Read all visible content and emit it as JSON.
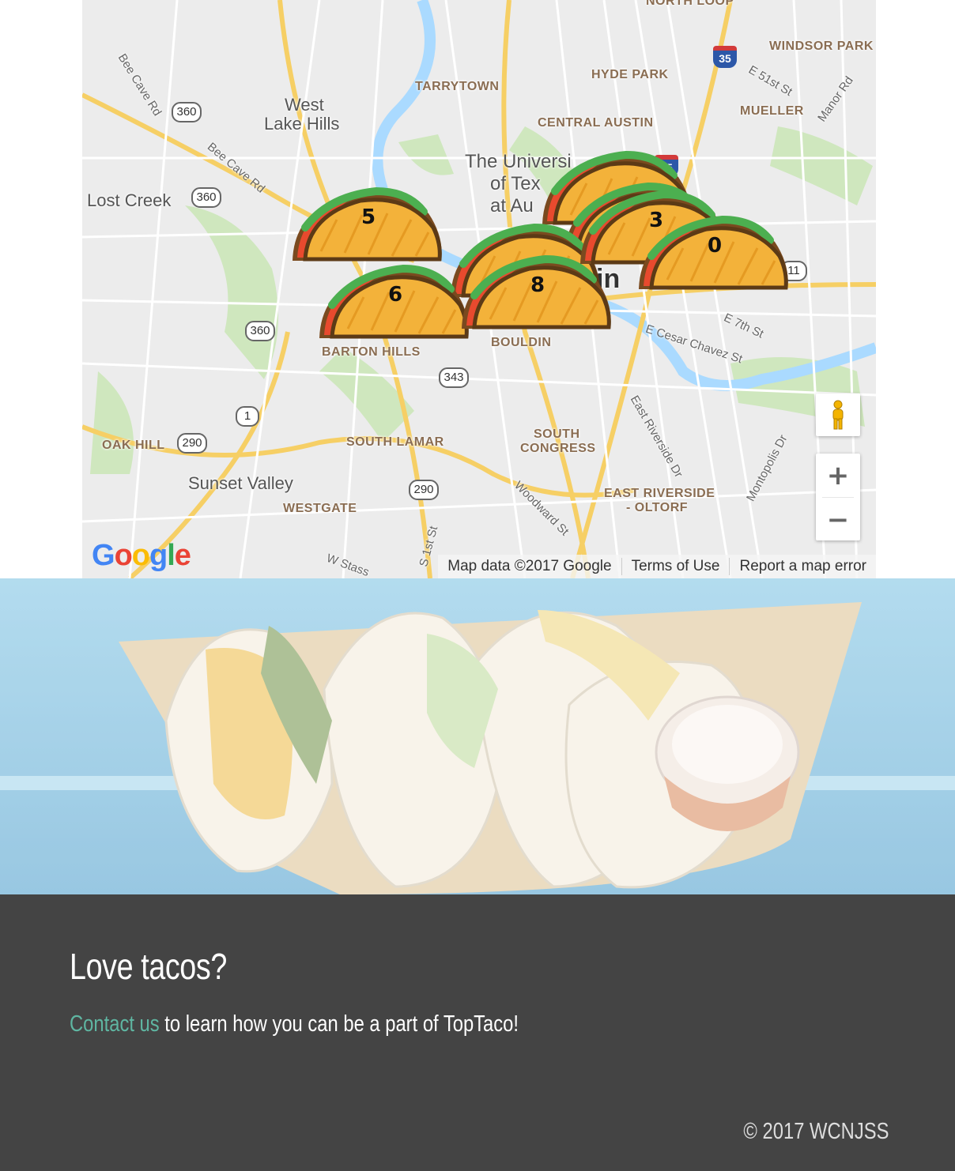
{
  "map": {
    "neighborhoods": [
      "NORTH LOOP",
      "WINDSOR PARK",
      "TARRYTOWN",
      "HYDE PARK",
      "MUELLER",
      "CENTRAL AUSTIN",
      "BARTON HILLS",
      "BOULDIN",
      "SOUTH LAMAR",
      "SOUTH",
      "CONGRESS",
      "OAK HILL",
      "WESTGATE",
      "EAST RIVERSIDE",
      "- OLTORF"
    ],
    "cities": [
      "West",
      "Lake Hills",
      "Lost Creek",
      "The Universi",
      "of Tex",
      "at Au",
      "Sunset Valley",
      "in"
    ],
    "streets": [
      "Bee Cave Rd",
      "Bee Cave Rd",
      "E 51st St",
      "Manor Rd",
      "E 7th St",
      "E Cesar Chavez St",
      "East Riverside Dr",
      "Montopolis Dr",
      "Woodward St",
      "S 1st St",
      "W Stass"
    ],
    "shields": [
      "360",
      "360",
      "360",
      "343",
      "1",
      "290",
      "290",
      "35",
      "35",
      "11"
    ],
    "markers": [
      {
        "count": "5",
        "label": "taco-cluster-marker"
      },
      {
        "count": "6",
        "label": "taco-cluster-marker"
      },
      {
        "count": "8",
        "label": "taco-cluster-marker"
      },
      {
        "count": "3",
        "label": "taco-cluster-marker"
      },
      {
        "count": "0",
        "label": "taco-cluster-marker"
      }
    ],
    "pegman_icon": "pegman-icon",
    "zoom_in_label": "+",
    "zoom_out_label": "−",
    "logo": "Google",
    "attribution": {
      "data": "Map data ©2017 Google",
      "terms": "Terms of Use",
      "report": "Report a map error"
    }
  },
  "footer": {
    "heading": "Love tacos?",
    "contact_link": "Contact us",
    "contact_text": " to learn how you can be a part of TopTaco!",
    "copyright": "© 2017 WCNJSS"
  },
  "colors": {
    "footer_bg": "#444444",
    "link": "#5fb6a2",
    "map_bg": "#ececec",
    "water": "#aadaff",
    "park": "#c9e6b6",
    "highway": "#f6cf65"
  }
}
